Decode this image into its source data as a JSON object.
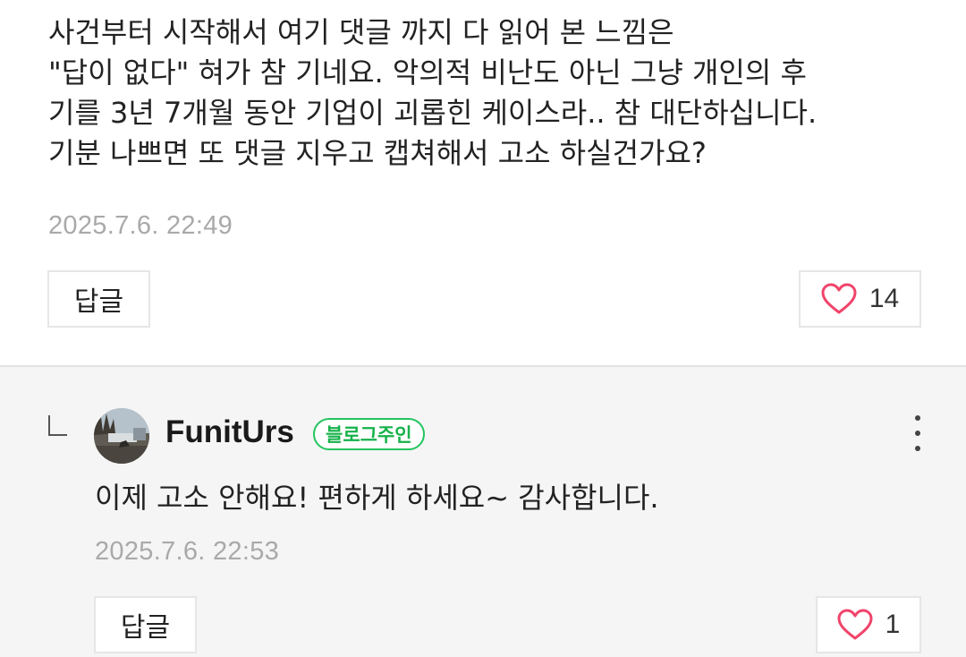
{
  "comment": {
    "lines": [
      "사건부터 시작해서 여기 댓글 까지 다 읽어 본 느낌은",
      "\"답이 없다\" 혀가 참 기네요. 악의적 비난도 아닌 그냥 개인의 후",
      "기를 3년 7개월 동안 기업이 괴롭힌 케이스라.. 참 대단하십니다.",
      "기분 나쁘면 또 댓글 지우고 캡쳐해서 고소 하실건가요?"
    ],
    "timestamp": "2025.7.6. 22:49",
    "reply_label": "답글",
    "like_count": "14"
  },
  "reply": {
    "author": "FunitUrs",
    "badge": "블로그주인",
    "text": "이제 고소 안해요! 편하게 하세요~ 감사합니다.",
    "timestamp": "2025.7.6. 22:53",
    "reply_label": "답글",
    "like_count": "1"
  },
  "icons": {
    "like": "heart-icon",
    "more": "more-vertical-icon",
    "reply_indicator": "reply-arrow-icon"
  },
  "colors": {
    "heart": "#f0446b",
    "badge": "#22c55e",
    "reply_background": "#f5f5f5",
    "timestamp": "#a9a9a9"
  }
}
